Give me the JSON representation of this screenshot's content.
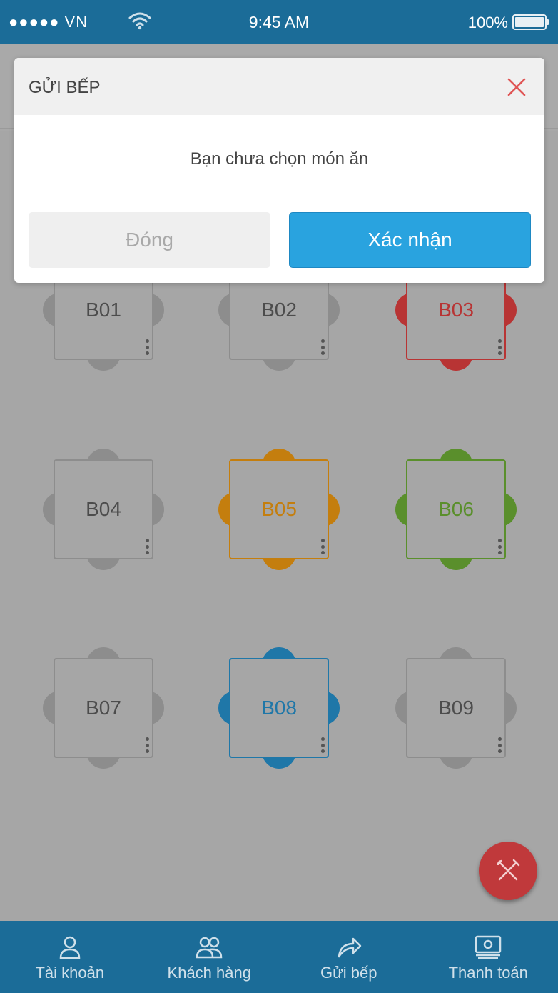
{
  "status_bar": {
    "carrier": "●●●●● VN",
    "time": "9:45 AM",
    "battery": "100%"
  },
  "tables": [
    {
      "label": "B01",
      "state": "empty",
      "color": "#8d8d8d",
      "text_color": "#4c4c4c"
    },
    {
      "label": "B02",
      "state": "empty",
      "color": "#8d8d8d",
      "text_color": "#4c4c4c"
    },
    {
      "label": "B03",
      "state": "red",
      "color": "#b83434",
      "text_color": "#b83434"
    },
    {
      "label": "B04",
      "state": "empty",
      "color": "#8d8d8d",
      "text_color": "#4c4c4c"
    },
    {
      "label": "B05",
      "state": "orange",
      "color": "#c47e0e",
      "text_color": "#c47e0e"
    },
    {
      "label": "B06",
      "state": "green",
      "color": "#5a8f2c",
      "text_color": "#5a8f2c"
    },
    {
      "label": "B07",
      "state": "empty",
      "color": "#8d8d8d",
      "text_color": "#4c4c4c"
    },
    {
      "label": "B08",
      "state": "blue",
      "color": "#1f77a8",
      "text_color": "#1f77a8"
    },
    {
      "label": "B09",
      "state": "empty",
      "color": "#8d8d8d",
      "text_color": "#4c4c4c"
    }
  ],
  "modal": {
    "title": "GỬI BẾP",
    "message": "Bạn chưa chọn món ăn",
    "close_label": "Đóng",
    "confirm_label": "Xác nhận"
  },
  "fab": {
    "icon": "utensils-icon",
    "color": "#c0393b"
  },
  "bottom_nav": [
    {
      "label": "Tài khoản",
      "icon": "user-icon"
    },
    {
      "label": "Khách hàng",
      "icon": "users-icon"
    },
    {
      "label": "Gửi bếp",
      "icon": "share-icon"
    },
    {
      "label": "Thanh toán",
      "icon": "cash-icon"
    }
  ],
  "colors": {
    "primary": "#1b6c98",
    "accent": "#29a3df",
    "danger": "#e05555"
  }
}
